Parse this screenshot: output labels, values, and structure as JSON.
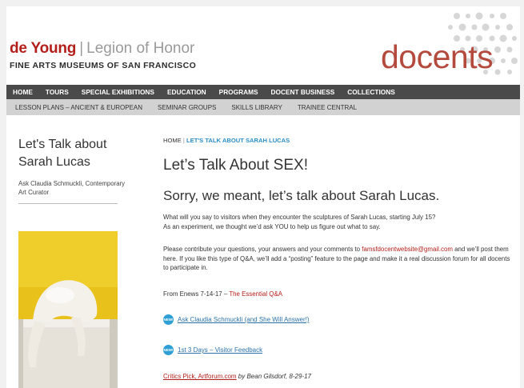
{
  "header": {
    "logo_deyoung": "de Young",
    "logo_separator": "|",
    "logo_legion": "Legion of Honor",
    "logo_subtitle": "FINE ARTS MUSEUMS OF SAN FRANCISCO",
    "section_title": "docents"
  },
  "nav": {
    "items": [
      "HOME",
      "TOURS",
      "SPECIAL EXHIBITIONS",
      "EDUCATION",
      "PROGRAMS",
      "DOCENT BUSINESS",
      "COLLECTIONS"
    ]
  },
  "subnav": {
    "items": [
      "LESSON PLANS – ANCIENT & EUROPEAN",
      "SEMINAR GROUPS",
      "SKILLS LIBRARY",
      "TRAINEE CENTRAL"
    ]
  },
  "sidebar": {
    "title": "Let's Talk about Sarah Lucas",
    "subtitle": "Ask Claudia Schmuckli, Contemporary Art Curator"
  },
  "main": {
    "breadcrumb_home": "HOME",
    "breadcrumb_sep": "|",
    "breadcrumb_current": "LET'S TALK ABOUT SARAH LUCAS",
    "heading": "Let’s Talk About SEX!",
    "subheading": "Sorry, we meant, let’s talk about Sarah Lucas.",
    "para1_line1": "What will you say to visitors when they encounter the sculptures of Sarah Lucas, starting July 15?",
    "para1_line2": "As an experiment, we thought we’d ask YOU to help us figure out what to say.",
    "para2_before": "Please contribute your questions, your answers and your comments to ",
    "email": "famsfdocentwebsite@gmail.com",
    "para2_after": " and we’ll post them here. If you like this type of Q&A, we’ll add a “posting” feature to the page and make it a real discussion forum for all docents to participate in.",
    "enews_prefix": "From Enews 7-14-17 – ",
    "enews_title": "The Essential Q&A",
    "new_badge": "NEW!",
    "link1": "Ask Claudia Schmuckli (and She Will Answer!)",
    "link2": "1st 3 Days – Visitor Feedback",
    "critics_link": "Critics Pick, Artforum.com",
    "critics_by": " by Bean Gilsdorf, 8-29-17"
  },
  "colors": {
    "brand_red": "#b3201b",
    "docents_red": "#b44a3e",
    "nav_bg": "#4a4a4a",
    "subnav_bg": "#d2d2d2",
    "link_blue": "#2b72a8",
    "badge_blue": "#2d9fd5",
    "photo_yellow": "#e8c21a"
  }
}
